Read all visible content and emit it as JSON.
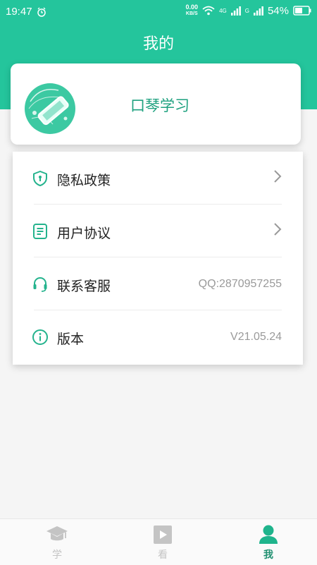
{
  "status_bar": {
    "time": "19:47",
    "net_speed_value": "0.00",
    "net_speed_unit": "KB/S",
    "signal_label_1": "4G",
    "signal_label_2": "G",
    "battery": "54%"
  },
  "header": {
    "title": "我的"
  },
  "profile": {
    "name": "口琴学习",
    "avatar_icon": "harmonica-avatar-icon"
  },
  "menu": {
    "items": [
      {
        "label": "隐私政策",
        "icon": "shield-lock-icon",
        "value": "",
        "has_chevron": true
      },
      {
        "label": "用户协议",
        "icon": "document-icon",
        "value": "",
        "has_chevron": true
      },
      {
        "label": "联系客服",
        "icon": "headset-icon",
        "value": "QQ:2870957255",
        "has_chevron": false
      },
      {
        "label": "版本",
        "icon": "info-icon",
        "value": "V21.05.24",
        "has_chevron": false
      }
    ]
  },
  "tabbar": {
    "tabs": [
      {
        "label": "学",
        "icon": "graduation-cap-icon",
        "active": false
      },
      {
        "label": "看",
        "icon": "play-video-icon",
        "active": false
      },
      {
        "label": "我",
        "icon": "user-icon",
        "active": true
      }
    ]
  },
  "colors": {
    "accent": "#24c59c",
    "tab_inactive": "#c4c4c4",
    "tab_active": "#1f8f70"
  }
}
